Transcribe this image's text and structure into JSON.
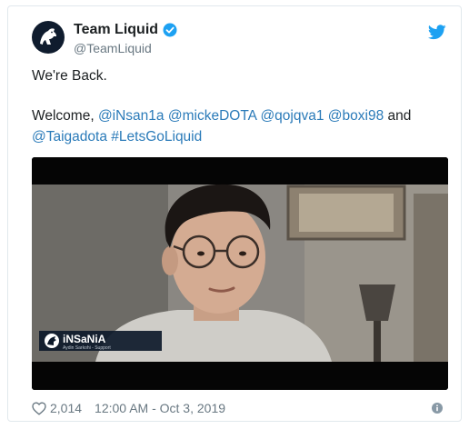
{
  "author": {
    "display_name": "Team Liquid",
    "handle": "@TeamLiquid",
    "verified": true,
    "avatar_icon": "team-liquid-horse-logo"
  },
  "brand_icon": "twitter-bird-icon",
  "tweet": {
    "line1": "We're Back.",
    "welcome_prefix": "Welcome,",
    "mentions_line2": [
      "@iNsan1a",
      "@mickeDOTA",
      "@qojqva1",
      "@boxi98"
    ],
    "and_word": "and",
    "mention_line3": "@Taigadota",
    "hashtag": "#LetsGoLiquid"
  },
  "media": {
    "type": "video",
    "lower_third_name": "iNSaNiA",
    "lower_third_sub": "Aydin Sarkohi - Support"
  },
  "footer": {
    "likes": "2,014",
    "timestamp": "12:00 AM - Oct 3, 2019"
  },
  "colors": {
    "link": "#2b7bb9",
    "twitter_blue": "#1da1f2",
    "muted": "#697882",
    "border": "#e1e8ed"
  }
}
